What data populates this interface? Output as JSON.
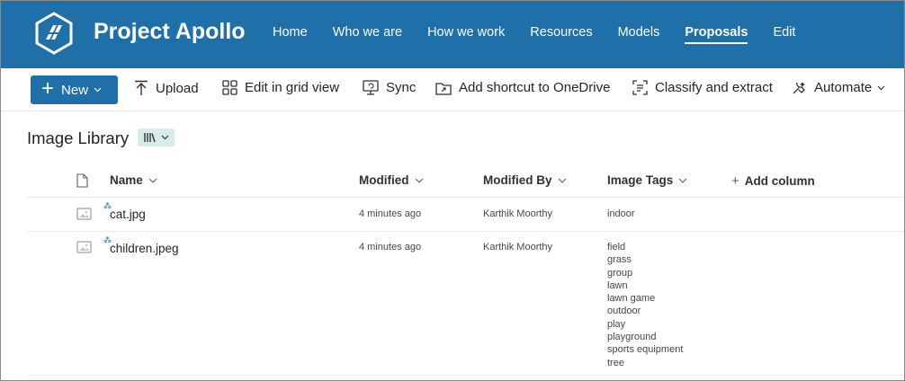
{
  "site": {
    "title": "Project Apollo",
    "brand_color": "#1f6fa8"
  },
  "nav": [
    "Home",
    "Who we are",
    "How we work",
    "Resources",
    "Models",
    "Proposals",
    "Edit"
  ],
  "nav_active": "Proposals",
  "command_bar": {
    "new_label": "New",
    "upload": "Upload",
    "grid_view": "Edit in grid view",
    "sync": "Sync",
    "shortcut": "Add shortcut to OneDrive",
    "classify": "Classify and extract",
    "automate": "Automate"
  },
  "library": {
    "title": "Image Library",
    "view_icon": "library-icon"
  },
  "columns": {
    "name": "Name",
    "modified": "Modified",
    "modified_by": "Modified By",
    "image_tags": "Image Tags",
    "add_column": "Add column"
  },
  "rows": [
    {
      "name": "cat.jpg",
      "modified": "4 minutes ago",
      "modified_by": "Karthik Moorthy",
      "tags": [
        "indoor"
      ]
    },
    {
      "name": "children.jpeg",
      "modified": "4 minutes ago",
      "modified_by": "Karthik Moorthy",
      "tags": [
        "field",
        "grass",
        "group",
        "lawn",
        "lawn game",
        "outdoor",
        "play",
        "playground",
        "sports equipment",
        "tree"
      ]
    }
  ]
}
